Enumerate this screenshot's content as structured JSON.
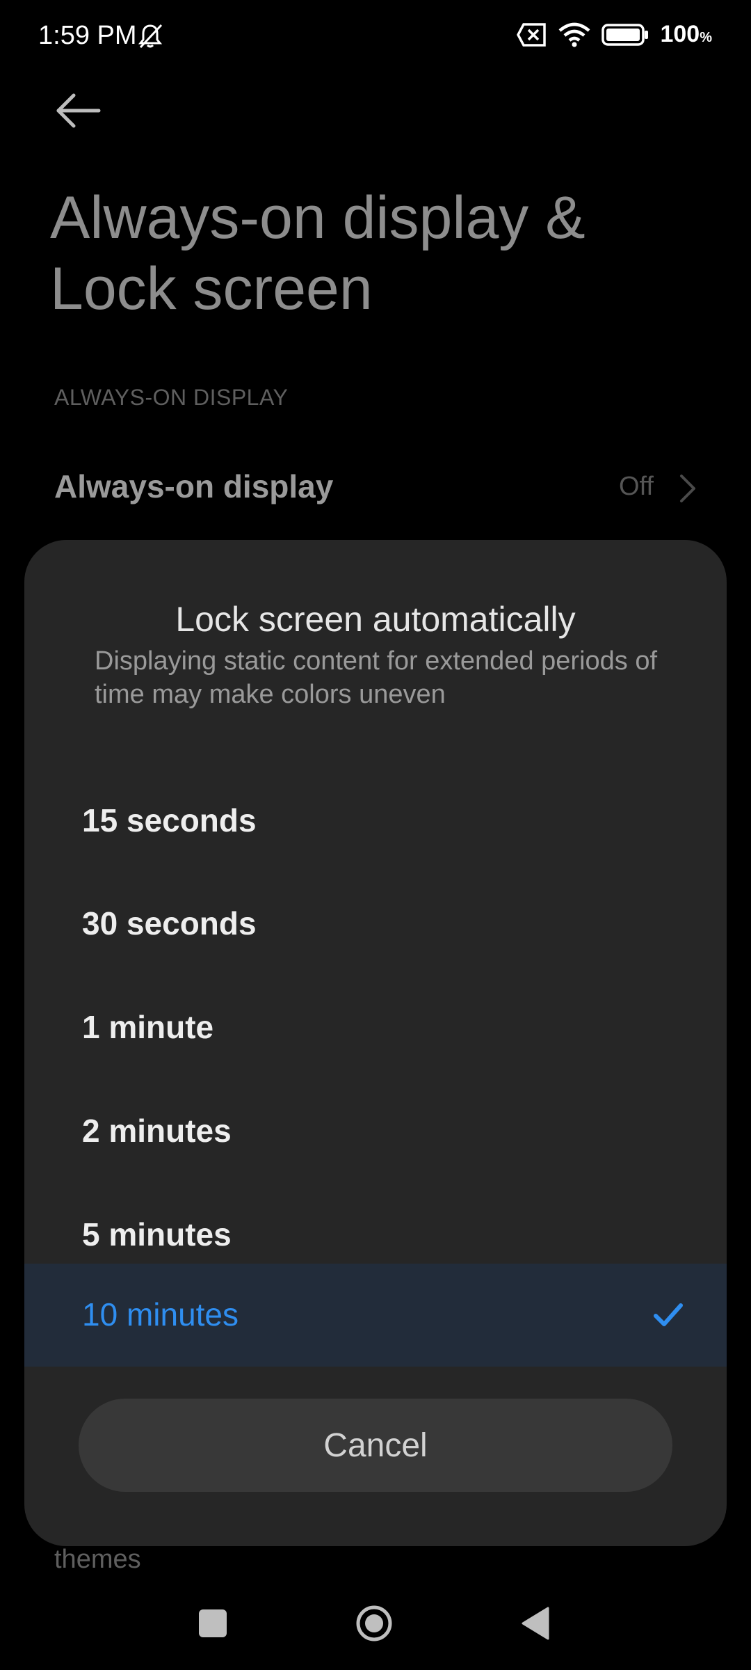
{
  "status_bar": {
    "time": "1:59 PM",
    "battery_percent": "100",
    "battery_unit": "%",
    "icons": [
      "bell-off-icon",
      "sim-error-icon",
      "wifi-icon",
      "battery-icon"
    ]
  },
  "header": {
    "title": "Always-on display & Lock screen",
    "back_icon": "arrow-left-icon"
  },
  "section": {
    "header": "ALWAYS-ON DISPLAY",
    "aod_label": "Always-on display",
    "aod_value": "Off"
  },
  "behind_text": "themes",
  "dialog": {
    "title": "Lock screen automatically",
    "subtitle": "Displaying static content for extended periods of time may make colors uneven",
    "options": [
      {
        "label": "15 seconds",
        "selected": false
      },
      {
        "label": "30 seconds",
        "selected": false
      },
      {
        "label": "1 minute",
        "selected": false
      },
      {
        "label": "2 minutes",
        "selected": false
      },
      {
        "label": "5 minutes",
        "selected": false
      },
      {
        "label": "10 minutes",
        "selected": true
      }
    ],
    "cancel_label": "Cancel"
  },
  "colors": {
    "accent": "#2f8ef0",
    "dialog_bg": "#262626",
    "selected_bg": "#222c3a"
  }
}
